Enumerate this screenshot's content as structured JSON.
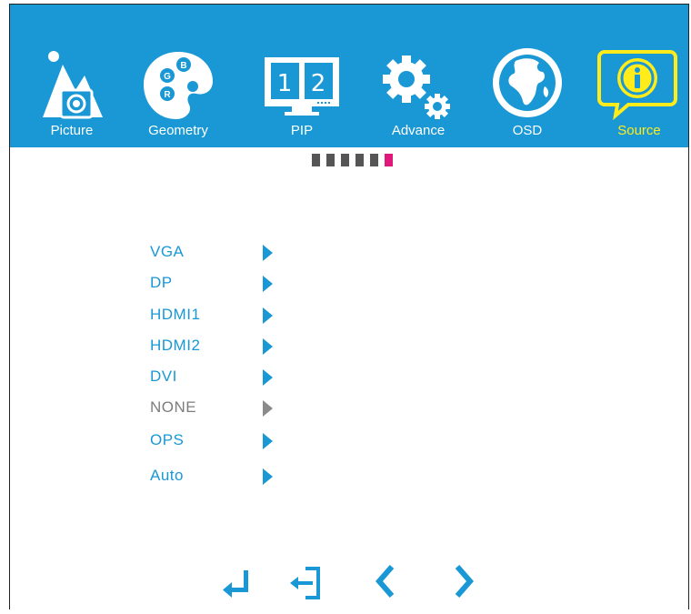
{
  "tabs": [
    {
      "label": "Picture",
      "icon": "picture-icon"
    },
    {
      "label": "Geometry",
      "icon": "palette-icon",
      "palette_letters": [
        "B",
        "G",
        "R"
      ]
    },
    {
      "label": "PIP",
      "icon": "pip-icon",
      "pip_numbers": [
        "1",
        "2"
      ]
    },
    {
      "label": "Advance",
      "icon": "gears-icon"
    },
    {
      "label": "OSD",
      "icon": "globe-icon"
    },
    {
      "label": "Source",
      "icon": "info-icon",
      "active": true
    }
  ],
  "page_indicator": {
    "total": 6,
    "active_index": 5
  },
  "source_menu": {
    "items": [
      {
        "label": "VGA",
        "enabled": true
      },
      {
        "label": "DP",
        "enabled": true
      },
      {
        "label": "HDMI1",
        "enabled": true
      },
      {
        "label": "HDMI2",
        "enabled": true
      },
      {
        "label": "DVI",
        "enabled": true
      },
      {
        "label": "NONE",
        "enabled": false
      },
      {
        "label": "OPS",
        "enabled": true
      },
      {
        "label": "Auto",
        "enabled": true
      }
    ]
  },
  "nav_buttons": [
    "enter-icon",
    "exit-icon",
    "chevron-left-icon",
    "chevron-right-icon"
  ],
  "colors": {
    "accent": "#1a98d5",
    "active_tab": "#ffec1a",
    "indicator_active": "#e0187a",
    "disabled": "#7d7d7d"
  }
}
